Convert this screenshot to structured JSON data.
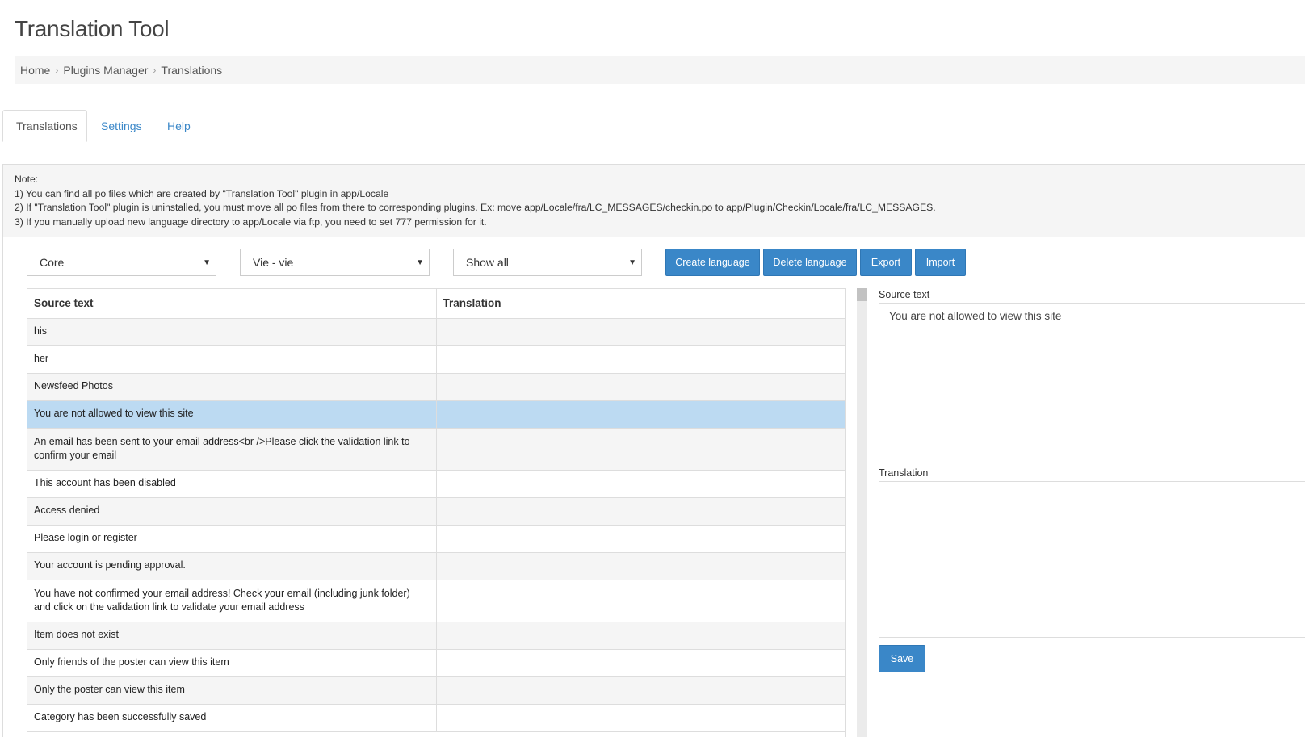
{
  "page": {
    "title": "Translation Tool"
  },
  "breadcrumb": [
    "Home",
    "Plugins Manager",
    "Translations"
  ],
  "tabs": [
    {
      "label": "Translations",
      "active": true
    },
    {
      "label": "Settings",
      "active": false
    },
    {
      "label": "Help",
      "active": false
    }
  ],
  "note": {
    "heading": "Note:",
    "lines": [
      "1) You can find all po files which are created by \"Translation Tool\" plugin in app/Locale",
      "2) If \"Translation Tool\" plugin is uninstalled, you must move all po files from there to corresponding plugins. Ex: move app/Locale/fra/LC_MESSAGES/checkin.po to app/Plugin/Checkin/Locale/fra/LC_MESSAGES.",
      "3) If you manually upload new language directory to app/Locale via ftp, you need to set 777 permission for it."
    ]
  },
  "filters": {
    "plugin": "Core",
    "language": "Vie - vie",
    "status": "Show all"
  },
  "actions": {
    "create_language": "Create language",
    "delete_language": "Delete language",
    "export": "Export",
    "import": "Import"
  },
  "table": {
    "columns": [
      "Source text",
      "Translation"
    ],
    "rows": [
      {
        "source": "his",
        "translation": ""
      },
      {
        "source": "her",
        "translation": ""
      },
      {
        "source": "Newsfeed Photos",
        "translation": ""
      },
      {
        "source": "You are not allowed to view this site",
        "translation": "",
        "selected": true
      },
      {
        "source": "An email has been sent to your email address<br />Please click the validation link to confirm your email",
        "translation": ""
      },
      {
        "source": "This account has been disabled",
        "translation": ""
      },
      {
        "source": "Access denied",
        "translation": ""
      },
      {
        "source": "Please login or register",
        "translation": ""
      },
      {
        "source": "Your account is pending approval.",
        "translation": ""
      },
      {
        "source": "You have not confirmed your email address! Check your email (including junk folder) and click on the validation link to validate your email address",
        "translation": ""
      },
      {
        "source": "Item does not exist",
        "translation": ""
      },
      {
        "source": "Only friends of the poster can view this item",
        "translation": ""
      },
      {
        "source": "Only the poster can view this item",
        "translation": ""
      },
      {
        "source": "Category has been successfully saved",
        "translation": ""
      }
    ]
  },
  "editor": {
    "source_label": "Source text",
    "source_value": "You are not allowed to view this site",
    "translation_label": "Translation",
    "translation_value": "",
    "save_label": "Save"
  },
  "icons": {
    "breadcrumb_separator": "chevron-right-icon",
    "select_caret": "caret-down-icon"
  },
  "colors": {
    "primary": "#3a87c8",
    "selected_row": "#bcdaf2",
    "stripe": "#f5f5f5"
  }
}
